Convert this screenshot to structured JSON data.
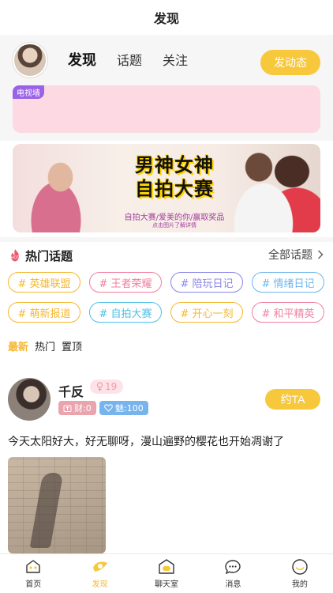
{
  "header": {
    "title": "发现"
  },
  "top_tabs": [
    {
      "label": "发现",
      "active": true
    },
    {
      "label": "话题",
      "active": false
    },
    {
      "label": "关注",
      "active": false
    }
  ],
  "post_button": {
    "label": "发动态"
  },
  "tv_card": {
    "badge": "电视墙"
  },
  "banner": {
    "title_line1": "男神女神",
    "title_line2": "自拍大赛",
    "subtitle": "自拍大赛/爱美的你/赢取奖品",
    "hint": "点击图片了解详情"
  },
  "hot_topics": {
    "title": "热门话题",
    "all_label": "全部话题",
    "tags": [
      {
        "label": "# 英雄联盟",
        "color": "#f5b731"
      },
      {
        "label": "# 王者荣耀",
        "color": "#f07fa0"
      },
      {
        "label": "# 陪玩日记",
        "color": "#8a86e6"
      },
      {
        "label": "# 情绪日记",
        "color": "#6fb6ec"
      },
      {
        "label": "# 萌新报道",
        "color": "#f5b731"
      },
      {
        "label": "# 自拍大赛",
        "color": "#4fbfe6"
      },
      {
        "label": "# 开心一刻",
        "color": "#f5b731"
      },
      {
        "label": "# 和平精英",
        "color": "#f07fa0"
      }
    ]
  },
  "feed_tabs": [
    {
      "label": "最新",
      "active": true
    },
    {
      "label": "热门",
      "active": false
    },
    {
      "label": "置顶",
      "active": false
    }
  ],
  "post": {
    "user_name": "千反",
    "age": "19",
    "wealth": "财:0",
    "charm": "魅:100",
    "date_label": "约TA",
    "text": "今天太阳好大，好无聊呀，漫山遍野的樱花也开始凋谢了"
  },
  "tabbar": [
    {
      "label": "首页",
      "icon": "home-icon",
      "active": false
    },
    {
      "label": "发现",
      "icon": "discover-icon",
      "active": true
    },
    {
      "label": "聊天室",
      "icon": "chatroom-icon",
      "active": false
    },
    {
      "label": "消息",
      "icon": "message-icon",
      "active": false
    },
    {
      "label": "我的",
      "icon": "profile-icon",
      "active": false
    }
  ],
  "colors": {
    "accent": "#f8c83c",
    "active_text": "#f5b731",
    "tv_card_bg": "#fdd9e3"
  }
}
